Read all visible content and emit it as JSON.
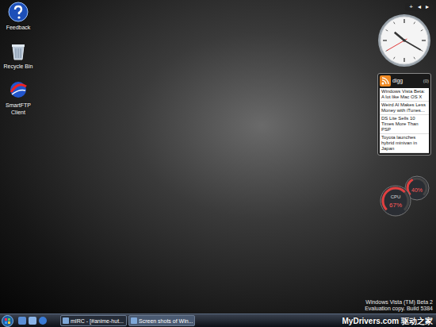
{
  "desktop_icons": [
    {
      "label": "Feedback"
    },
    {
      "label": "Recycle Bin"
    },
    {
      "label": "SmartFTP Client"
    }
  ],
  "sidebar": {
    "controls": [
      "+",
      "◂",
      "▸"
    ]
  },
  "clock": {
    "hour": 10,
    "minute": 20,
    "second": 40
  },
  "digg": {
    "title": "digg",
    "count": "(0)",
    "items": [
      {
        "text": "Windows Vista Beta: A lot like Mac OS X",
        "selected": false
      },
      {
        "text": "Weird Al Makes Less Money with iTunes...",
        "selected": false
      },
      {
        "text": "DS Lite Sells 10 Times More Than PSP",
        "selected": false
      },
      {
        "text": "Toyota launches hybrid minivan in Japan",
        "selected": false
      }
    ]
  },
  "meter": {
    "cpu_label": "CPU",
    "cpu": "67%",
    "cpu_level": 0.67,
    "memory": "40%",
    "memory_level": 0.4
  },
  "watermark": {
    "lines": [
      "Windows Vista (TM) Beta 2",
      "Evaluation copy. Build 5384"
    ]
  },
  "taskbar": {
    "buttons": [
      {
        "label": "mIRC - [#anime-hut...",
        "selected": false
      },
      {
        "label": "Screen shots of Win...",
        "selected": true
      }
    ]
  },
  "site_watermark": {
    "text": "MyDrivers.com 驱动之家"
  }
}
